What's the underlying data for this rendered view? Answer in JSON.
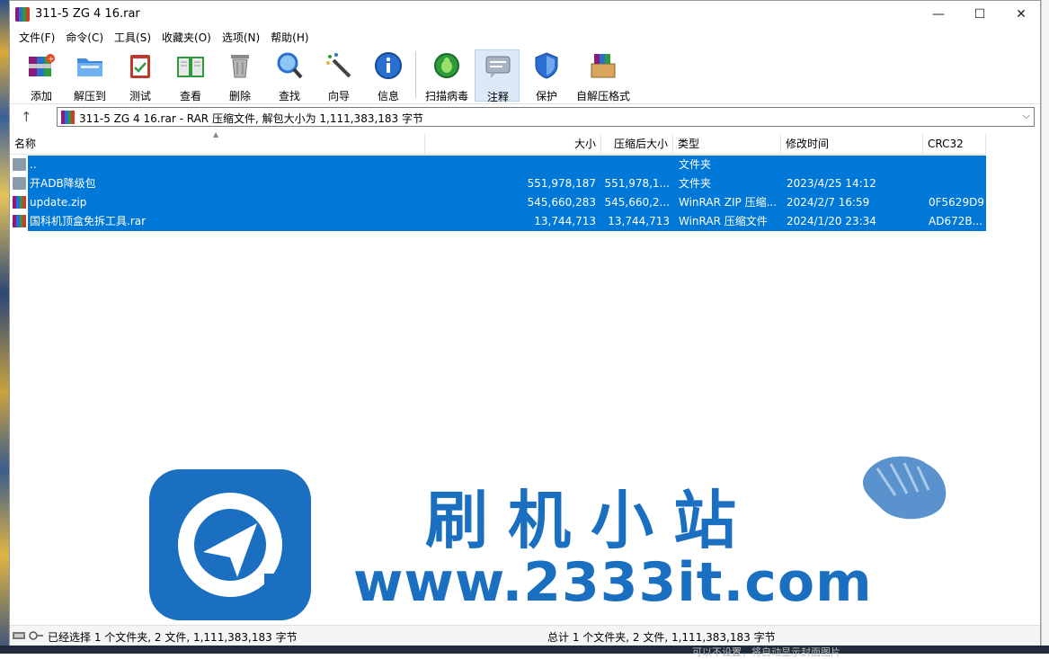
{
  "window": {
    "title": "311-5 ZG 4 16.rar",
    "controls": {
      "minimize": "—",
      "maximize": "☐",
      "close": "✕"
    }
  },
  "menu": [
    "文件(F)",
    "命令(C)",
    "工具(S)",
    "收藏夹(O)",
    "选项(N)",
    "帮助(H)"
  ],
  "toolbar": {
    "add": "添加",
    "extract": "解压到",
    "test": "测试",
    "view": "查看",
    "delete": "删除",
    "find": "查找",
    "wizard": "向导",
    "info": "信息",
    "scan": "扫描病毒",
    "comment": "注释",
    "protect": "保护",
    "sfx": "自解压格式"
  },
  "address": {
    "text": "311-5 ZG 4 16.rar - RAR 压缩文件, 解包大小为 1,111,383,183 字节",
    "up": "↑",
    "dropdown": "⌵"
  },
  "columns": {
    "name": "名称",
    "size": "大小",
    "packed": "压缩后大小",
    "type": "类型",
    "modified": "修改时间",
    "crc": "CRC32"
  },
  "files": [
    {
      "name": "..",
      "size": "",
      "packed": "",
      "type": "文件夹",
      "modified": "",
      "crc": "",
      "icon": "folder-icon"
    },
    {
      "name": "开ADB降级包",
      "size": "551,978,187",
      "packed": "551,978,1...",
      "type": "文件夹",
      "modified": "2023/4/25 14:12",
      "crc": "",
      "icon": "folder-icon"
    },
    {
      "name": "update.zip",
      "size": "545,660,283",
      "packed": "545,660,2...",
      "type": "WinRAR ZIP 压缩...",
      "modified": "2024/2/7 16:59",
      "crc": "0F5629D9",
      "icon": "archive-icon"
    },
    {
      "name": "国科机顶盒免拆工具.rar",
      "size": "13,744,713",
      "packed": "13,744,713",
      "type": "WinRAR 压缩文件",
      "modified": "2024/1/20 23:34",
      "crc": "AD672B...",
      "icon": "archive-icon"
    }
  ],
  "watermark": {
    "title": "刷机小站",
    "url": "www.2333it.com"
  },
  "status": {
    "left": "已经选择 1 个文件夹, 2 文件, 1,111,383,183 字节",
    "right": "总计 1 个文件夹, 2 文件, 1,111,383,183 字节"
  },
  "desktop": {
    "bottom_text": "可以不设置，将自动显示封面图片"
  },
  "colors": {
    "selection": "#0078d7",
    "watermark": "#1a6fc0"
  }
}
